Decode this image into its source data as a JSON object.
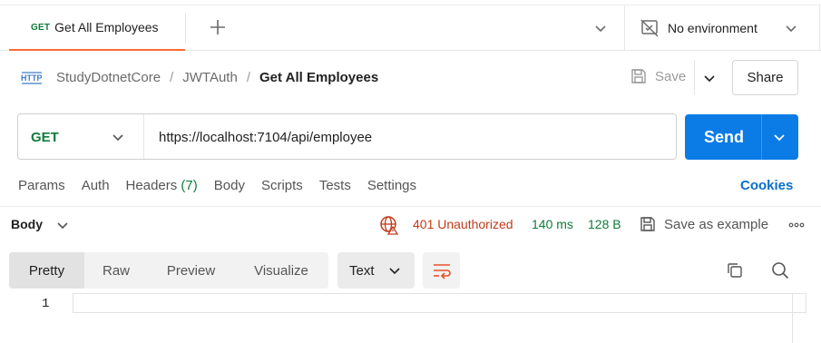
{
  "tabs": {
    "active": {
      "method": "GET",
      "title": "Get All Employees"
    },
    "environment": "No environment"
  },
  "request": {
    "breadcrumb": [
      "StudyDotnetCore",
      "JWTAuth",
      "Get All Employees"
    ],
    "save_label": "Save",
    "share_label": "Share",
    "method": "GET",
    "url": "https://localhost:7104/api/employee",
    "send_label": "Send"
  },
  "request_tabs": {
    "items": [
      "Params",
      "Auth",
      "Headers",
      "Body",
      "Scripts",
      "Tests",
      "Settings"
    ],
    "headers_count": "(7)",
    "cookies_label": "Cookies"
  },
  "response": {
    "body_label": "Body",
    "status": "401 Unauthorized",
    "time": "140 ms",
    "size": "128 B",
    "save_example_label": "Save as example",
    "view_tabs": [
      "Pretty",
      "Raw",
      "Preview",
      "Visualize"
    ],
    "format": "Text",
    "line_number": "1"
  },
  "colors": {
    "accent": "#ff6c37",
    "send": "#0b7be6",
    "method_get": "#0f7b3a",
    "error": "#c03a1a",
    "link": "#0b6ec9"
  },
  "icons": {
    "add_tab": "plus-icon",
    "overflow": "chevron-down-icon",
    "environment": "no-environment-icon",
    "request_type": "http-icon",
    "save": "save-icon",
    "status": "globe-error-icon",
    "more": "more-icon",
    "wrap": "wrap-lines-icon",
    "copy": "copy-icon",
    "search": "search-icon"
  }
}
